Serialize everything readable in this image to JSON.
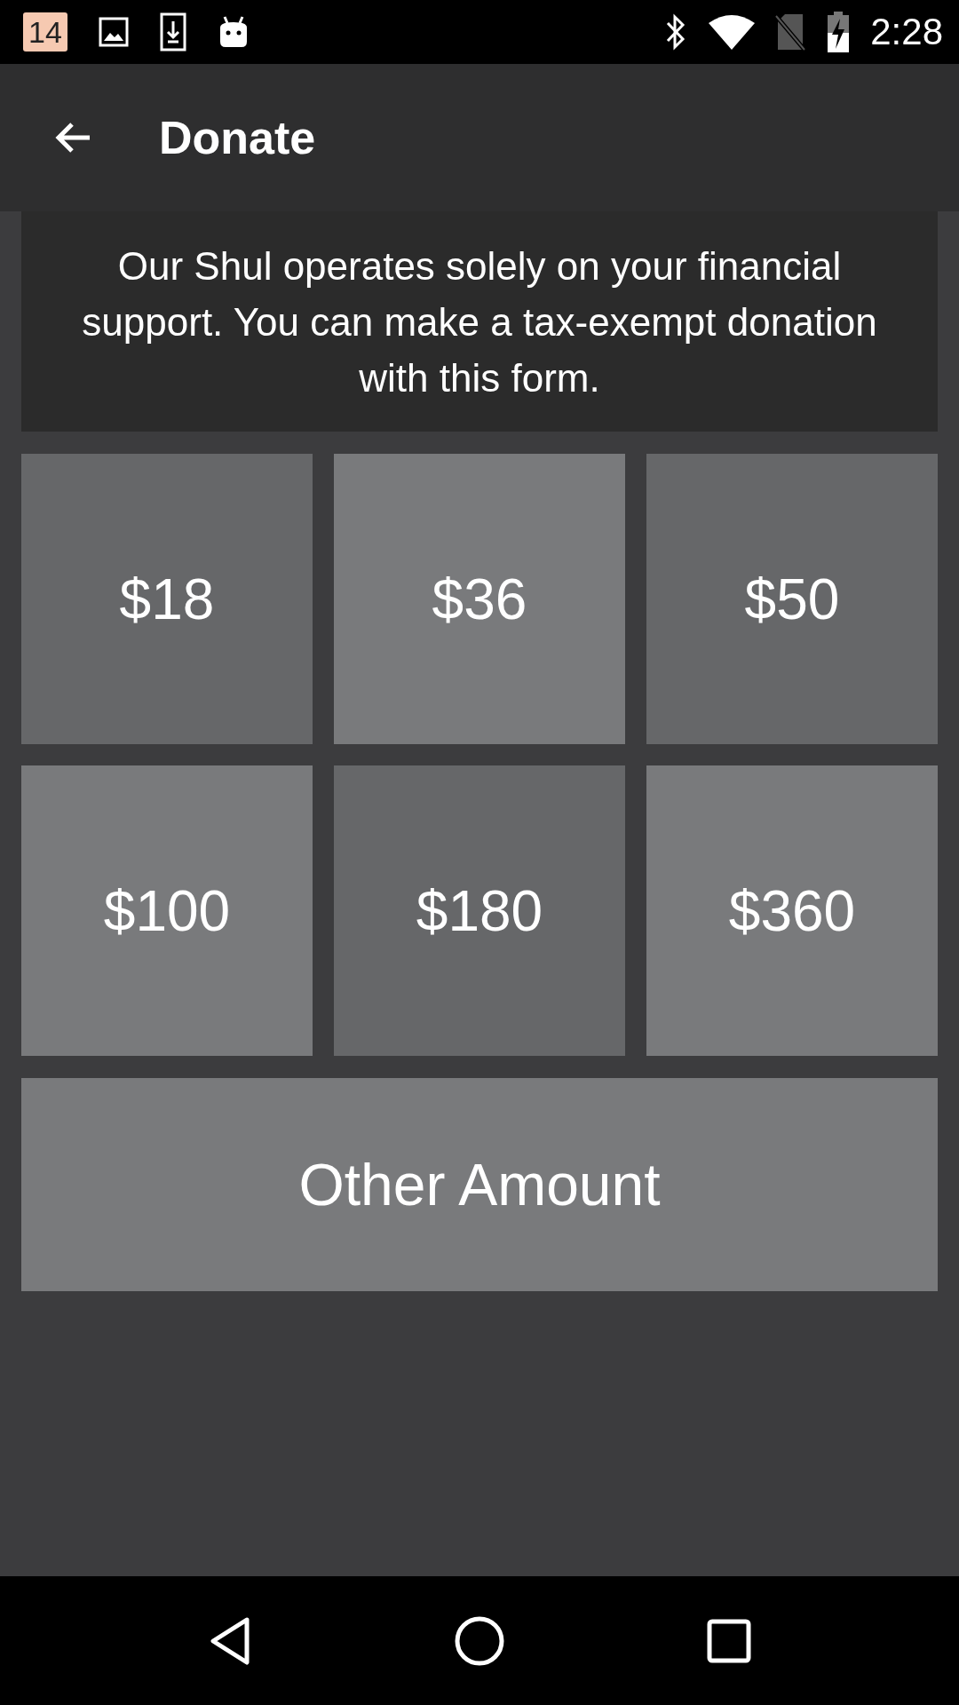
{
  "status_bar": {
    "time": "2:28",
    "notification_badge": "14"
  },
  "app_bar": {
    "title": "Donate"
  },
  "intro": "Our Shul operates solely on your financial support. You can make a tax-exempt donation with this form.",
  "amounts": [
    "$18",
    "$36",
    "$50",
    "$100",
    "$180",
    "$360"
  ],
  "other_button": "Other Amount"
}
